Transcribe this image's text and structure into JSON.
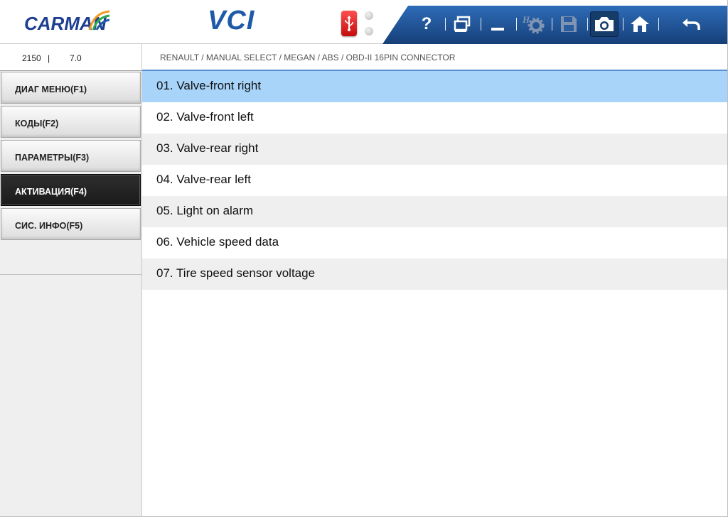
{
  "header": {
    "logo_text": "CARMAN",
    "product_title": "VCI"
  },
  "toolbar": {
    "help_label": "?",
    "buttons": [
      {
        "name": "help-icon"
      },
      {
        "name": "window-restore-icon"
      },
      {
        "name": "minimize-icon"
      },
      {
        "name": "h-settings-icon"
      },
      {
        "name": "save-icon"
      },
      {
        "name": "camera-icon"
      },
      {
        "name": "home-icon"
      },
      {
        "name": "back-icon"
      }
    ]
  },
  "status": {
    "value1": "2150",
    "separator": "|",
    "value2": "7.0"
  },
  "breadcrumb": "RENAULT / MANUAL SELECT / MEGAN / ABS / OBD-II 16PIN CONNECTOR",
  "sidebar": {
    "items": [
      {
        "label": "ДИАГ МЕНЮ(F1)",
        "active": false
      },
      {
        "label": "КОДЫ(F2)",
        "active": false
      },
      {
        "label": "ПАРАМЕТРЫ(F3)",
        "active": false
      },
      {
        "label": "АКТИВАЦИЯ(F4)",
        "active": true
      },
      {
        "label": "СИС. ИНФО(F5)",
        "active": false
      }
    ]
  },
  "list": {
    "selected_index": 0,
    "items": [
      "01. Valve-front right",
      "02. Valve-front left",
      "03. Valve-rear right",
      "04. Valve-rear left",
      "05. Light on alarm",
      "06. Vehicle speed data",
      "07. Tire speed sensor voltage"
    ]
  },
  "colors": {
    "brand_blue": "#1e5aa8",
    "toolbar_blue": "#1f4f92",
    "selected_row": "#a8d4fa",
    "active_menu": "#1f1f1f"
  }
}
